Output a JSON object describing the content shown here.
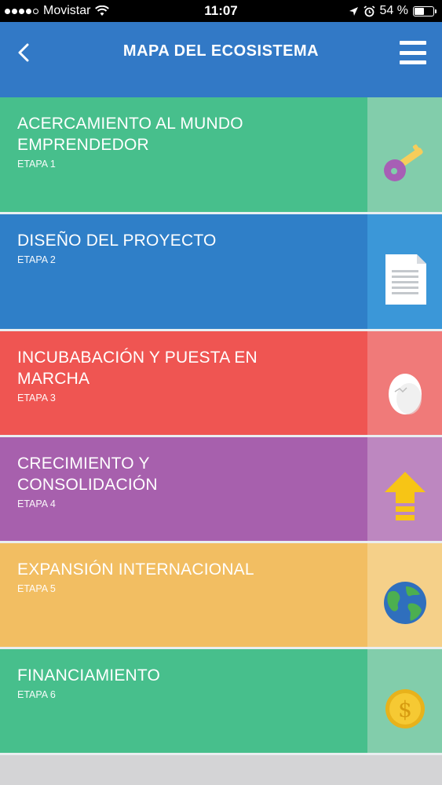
{
  "status_bar": {
    "carrier": "Movistar",
    "time": "11:07",
    "battery": "54 %",
    "battery_level": 0.54
  },
  "header": {
    "title": "MAPA DEL ECOSISTEMA",
    "back_icon": "chevron-left-icon",
    "menu_icon": "hamburger-menu-icon"
  },
  "stages": [
    {
      "title": "ACERCAMIENTO AL MUNDO EMPRENDEDOR",
      "subtitle": "ETAPA 1",
      "icon": "key-icon",
      "color": "#47bf8c",
      "side_color": "#82cdab"
    },
    {
      "title": "DISEÑO DEL PROYECTO",
      "subtitle": "ETAPA 2",
      "icon": "document-icon",
      "color": "#2f7fc8",
      "side_color": "#3b97d8"
    },
    {
      "title": "INCUBABACIÓN Y PUESTA EN MARCHA",
      "subtitle": "ETAPA 3",
      "icon": "egg-icon",
      "color": "#ef5552",
      "side_color": "#f07a79"
    },
    {
      "title": "CRECIMIENTO Y CONSOLIDACIÓN",
      "subtitle": "ETAPA 4",
      "icon": "arrow-up-icon",
      "color": "#a760ad",
      "side_color": "#bd87c0"
    },
    {
      "title": "EXPANSIÓN INTERNACIONAL",
      "subtitle": "ETAPA 5",
      "icon": "globe-icon",
      "color": "#f2be62",
      "side_color": "#f5d089"
    },
    {
      "title": "FINANCIAMIENTO",
      "subtitle": "ETAPA 6",
      "icon": "coin-icon",
      "color": "#47bf8c",
      "side_color": "#82cdab"
    }
  ]
}
